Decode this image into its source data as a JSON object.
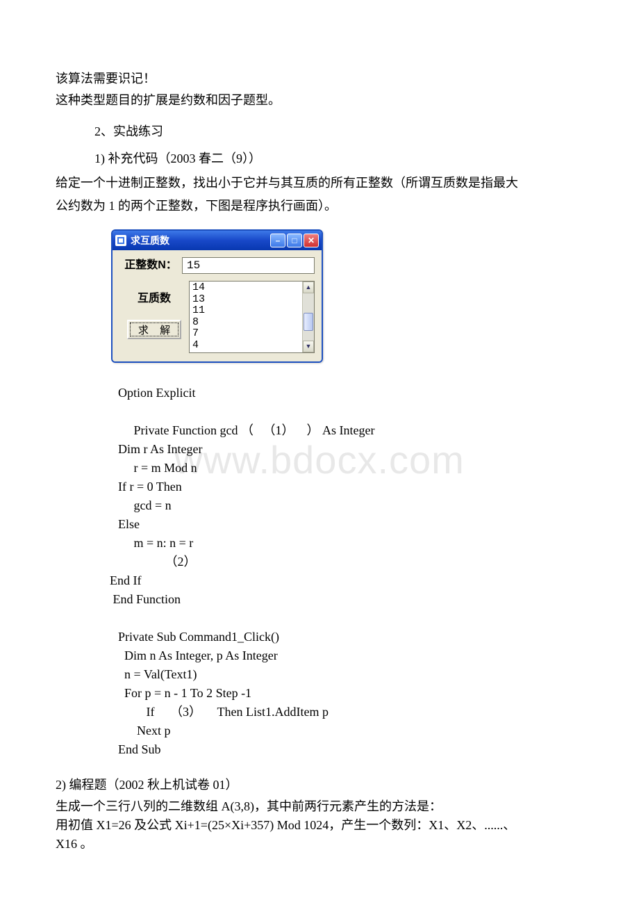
{
  "intro": {
    "line1": "该算法需要识记！",
    "line2": "这种类型题目的扩展是约数和因子题型。"
  },
  "section2": "2、实战练习",
  "q1": {
    "heading": "1)      补充代码（2003 春二（9））",
    "desc1": "给定一个十进制正整数，找出小于它并与其互质的所有正整数（所谓互质数是指最大",
    "desc2": "公约数为 1 的两个正整数，下图是程序执行画面）。"
  },
  "window": {
    "title": "求互质数",
    "label_n": "正整数N：",
    "label_coprime": "互质数",
    "input_value": "15",
    "list_items": [
      "14",
      "13",
      "11",
      "8",
      "7",
      "4"
    ],
    "button": "求 解"
  },
  "code": {
    "l0": "Option Explicit",
    "l1": "     Private Function gcd （   （1）    ） As Integer",
    "l2": "Dim r As Integer",
    "l3": "     r = m Mod n",
    "l4": "If r = 0 Then",
    "l5": "     gcd = n",
    "l6": "Else",
    "l7": "     m = n: n = r",
    "l8": "               （2）",
    "l9": "End If",
    "l10": " End Function",
    "l11": "",
    "l12": "Private Sub Command1_Click()",
    "l13": "  Dim n As Integer, p As Integer",
    "l14": "  n = Val(Text1)",
    "l15": "  For p = n - 1 To 2 Step -1",
    "l16": "         If     （3）     Then List1.AddItem p",
    "l17": "      Next p",
    "l18": "End Sub"
  },
  "q2": {
    "heading": "2)      编程题（2002 秋上机试卷 01）",
    "line1": "        生成一个三行八列的二维数组 A(3,8)，其中前两行元素产生的方法是：",
    "line2": "用初值 X1=26 及公式 Xi+1=(25×Xi+357) Mod 1024，产生一个数列：X1、X2、......、",
    "line3": "X16 。"
  },
  "watermark": "www.bdocx.com"
}
